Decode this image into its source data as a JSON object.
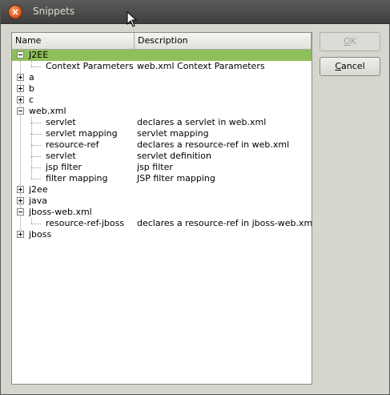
{
  "window": {
    "title": "Snippets"
  },
  "columns": {
    "name": "Name",
    "description": "Description"
  },
  "rows": [
    {
      "name": "J2EE",
      "desc": ""
    },
    {
      "name": "Context Parameters",
      "desc": "web.xml Context Parameters"
    },
    {
      "name": "a",
      "desc": ""
    },
    {
      "name": "b",
      "desc": ""
    },
    {
      "name": "c",
      "desc": ""
    },
    {
      "name": "web.xml",
      "desc": ""
    },
    {
      "name": "servlet",
      "desc": "declares a servlet in web.xml"
    },
    {
      "name": "servlet mapping",
      "desc": "servlet mapping"
    },
    {
      "name": "resource-ref",
      "desc": "declares a resource-ref in web.xml"
    },
    {
      "name": "servlet",
      "desc": "servlet definition"
    },
    {
      "name": "jsp filter",
      "desc": "jsp filter"
    },
    {
      "name": "filter mapping",
      "desc": "JSP filter mapping"
    },
    {
      "name": "j2ee",
      "desc": ""
    },
    {
      "name": "java",
      "desc": ""
    },
    {
      "name": "jboss-web.xml",
      "desc": ""
    },
    {
      "name": "resource-ref-jboss",
      "desc": "declares a resource-ref in jboss-web.xml"
    },
    {
      "name": "jboss",
      "desc": ""
    }
  ],
  "buttons": {
    "ok_first": "O",
    "ok_rest": "K",
    "cancel_first": "C",
    "cancel_rest": "ancel"
  },
  "colors": {
    "selection": "#8fbf5a",
    "titlebar": "#4a4a48"
  }
}
